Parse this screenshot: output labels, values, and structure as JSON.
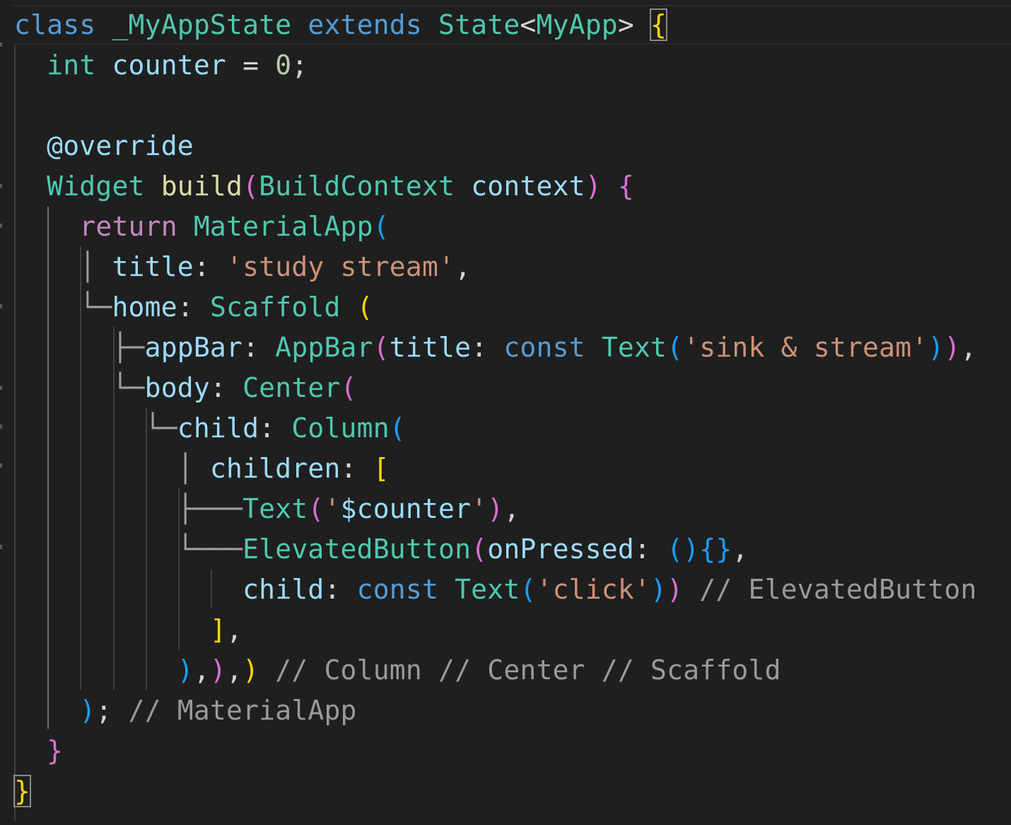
{
  "editor": {
    "language": "dart",
    "theme": "dark",
    "colors": {
      "background": "#1f1f1f",
      "keyword": "#569cd6",
      "control": "#c586c0",
      "type": "#4ec9b0",
      "variable": "#9cdcfe",
      "function": "#dcdcaa",
      "number": "#b5cea8",
      "string": "#ce9178",
      "comment": "#9a9a9a",
      "bracket_level_1": "#ffd700",
      "bracket_level_2": "#da70d6",
      "bracket_level_3": "#179fff"
    },
    "lines": [
      {
        "tokens": [
          {
            "t": "class",
            "c": "kw"
          },
          {
            "t": " "
          },
          {
            "t": "_MyAppState",
            "c": "type"
          },
          {
            "t": " "
          },
          {
            "t": "extends",
            "c": "kw"
          },
          {
            "t": " "
          },
          {
            "t": "State",
            "c": "type"
          },
          {
            "t": "<",
            "c": "punc"
          },
          {
            "t": "MyApp",
            "c": "type"
          },
          {
            "t": ">",
            "c": "punc"
          },
          {
            "t": " "
          },
          {
            "t": "{",
            "c": "br1",
            "box": true
          }
        ]
      },
      {
        "tokens": [
          {
            "t": "  "
          },
          {
            "t": "int",
            "c": "type"
          },
          {
            "t": " "
          },
          {
            "t": "counter",
            "c": "var"
          },
          {
            "t": " = ",
            "c": "punc"
          },
          {
            "t": "0",
            "c": "num"
          },
          {
            "t": ";",
            "c": "punc"
          }
        ]
      },
      {
        "tokens": []
      },
      {
        "tokens": [
          {
            "t": "  "
          },
          {
            "t": "@override",
            "c": "var"
          }
        ]
      },
      {
        "tokens": [
          {
            "t": "  "
          },
          {
            "t": "Widget",
            "c": "type"
          },
          {
            "t": " "
          },
          {
            "t": "build",
            "c": "fn"
          },
          {
            "t": "(",
            "c": "br2"
          },
          {
            "t": "BuildContext",
            "c": "type"
          },
          {
            "t": " "
          },
          {
            "t": "context",
            "c": "var"
          },
          {
            "t": ")",
            "c": "br2"
          },
          {
            "t": " "
          },
          {
            "t": "{",
            "c": "br2"
          }
        ]
      },
      {
        "tokens": [
          {
            "t": "    "
          },
          {
            "t": "return",
            "c": "ctrl"
          },
          {
            "t": " "
          },
          {
            "t": "MaterialApp",
            "c": "type"
          },
          {
            "t": "(",
            "c": "br3"
          }
        ]
      },
      {
        "tokens": [
          {
            "t": "    "
          },
          {
            "t": "│ ",
            "c": "tree"
          },
          {
            "t": "title",
            "c": "var"
          },
          {
            "t": ": ",
            "c": "punc"
          },
          {
            "t": "'study stream'",
            "c": "str"
          },
          {
            "t": ",",
            "c": "punc"
          }
        ]
      },
      {
        "tokens": [
          {
            "t": "    "
          },
          {
            "t": "└─",
            "c": "tree"
          },
          {
            "t": "home",
            "c": "var"
          },
          {
            "t": ": ",
            "c": "punc"
          },
          {
            "t": "Scaffold",
            "c": "type"
          },
          {
            "t": " "
          },
          {
            "t": "(",
            "c": "br1"
          }
        ]
      },
      {
        "tokens": [
          {
            "t": "      "
          },
          {
            "t": "├─",
            "c": "tree"
          },
          {
            "t": "appBar",
            "c": "var"
          },
          {
            "t": ": ",
            "c": "punc"
          },
          {
            "t": "AppBar",
            "c": "type"
          },
          {
            "t": "(",
            "c": "br2"
          },
          {
            "t": "title",
            "c": "var"
          },
          {
            "t": ": ",
            "c": "punc"
          },
          {
            "t": "const",
            "c": "kw"
          },
          {
            "t": " "
          },
          {
            "t": "Text",
            "c": "type"
          },
          {
            "t": "(",
            "c": "br3"
          },
          {
            "t": "'sink & stream'",
            "c": "str"
          },
          {
            "t": ")",
            "c": "br3"
          },
          {
            "t": ")",
            "c": "br2"
          },
          {
            "t": ",",
            "c": "punc"
          }
        ]
      },
      {
        "tokens": [
          {
            "t": "      "
          },
          {
            "t": "└─",
            "c": "tree"
          },
          {
            "t": "body",
            "c": "var"
          },
          {
            "t": ": ",
            "c": "punc"
          },
          {
            "t": "Center",
            "c": "type"
          },
          {
            "t": "(",
            "c": "br2"
          }
        ]
      },
      {
        "tokens": [
          {
            "t": "        "
          },
          {
            "t": "└─",
            "c": "tree"
          },
          {
            "t": "child",
            "c": "var"
          },
          {
            "t": ": ",
            "c": "punc"
          },
          {
            "t": "Column",
            "c": "type"
          },
          {
            "t": "(",
            "c": "br3"
          }
        ]
      },
      {
        "tokens": [
          {
            "t": "          "
          },
          {
            "t": "│ ",
            "c": "tree"
          },
          {
            "t": "children",
            "c": "var"
          },
          {
            "t": ": ",
            "c": "punc"
          },
          {
            "t": "[",
            "c": "br1"
          }
        ]
      },
      {
        "tokens": [
          {
            "t": "          "
          },
          {
            "t": "├───",
            "c": "tree"
          },
          {
            "t": "Text",
            "c": "type"
          },
          {
            "t": "(",
            "c": "br2"
          },
          {
            "t": "'",
            "c": "str"
          },
          {
            "t": "$counter",
            "c": "var"
          },
          {
            "t": "'",
            "c": "str"
          },
          {
            "t": ")",
            "c": "br2"
          },
          {
            "t": ",",
            "c": "punc"
          }
        ]
      },
      {
        "tokens": [
          {
            "t": "          "
          },
          {
            "t": "└───",
            "c": "tree"
          },
          {
            "t": "ElevatedButton",
            "c": "type"
          },
          {
            "t": "(",
            "c": "br2"
          },
          {
            "t": "onPressed",
            "c": "var"
          },
          {
            "t": ": ",
            "c": "punc"
          },
          {
            "t": "()",
            "c": "br3"
          },
          {
            "t": "{}",
            "c": "br3"
          },
          {
            "t": ",",
            "c": "punc"
          }
        ]
      },
      {
        "tokens": [
          {
            "t": "              "
          },
          {
            "t": "child",
            "c": "var"
          },
          {
            "t": ": ",
            "c": "punc"
          },
          {
            "t": "const",
            "c": "kw"
          },
          {
            "t": " "
          },
          {
            "t": "Text",
            "c": "type"
          },
          {
            "t": "(",
            "c": "br3"
          },
          {
            "t": "'click'",
            "c": "str"
          },
          {
            "t": ")",
            "c": "br3"
          },
          {
            "t": ")",
            "c": "br2"
          },
          {
            "t": " "
          },
          {
            "t": "// ElevatedButton",
            "c": "cmt"
          }
        ]
      },
      {
        "tokens": [
          {
            "t": "            "
          },
          {
            "t": "]",
            "c": "br1"
          },
          {
            "t": ",",
            "c": "punc"
          }
        ]
      },
      {
        "tokens": [
          {
            "t": "          "
          },
          {
            "t": ")",
            "c": "br3"
          },
          {
            "t": ",",
            "c": "punc"
          },
          {
            "t": ")",
            "c": "br2"
          },
          {
            "t": ",",
            "c": "punc"
          },
          {
            "t": ")",
            "c": "br1"
          },
          {
            "t": " "
          },
          {
            "t": "// Column // Center // Scaffold",
            "c": "cmt"
          }
        ]
      },
      {
        "tokens": [
          {
            "t": "    "
          },
          {
            "t": ")",
            "c": "br3"
          },
          {
            "t": ";",
            "c": "punc"
          },
          {
            "t": " "
          },
          {
            "t": "// MaterialApp",
            "c": "cmt"
          }
        ]
      },
      {
        "tokens": [
          {
            "t": "  "
          },
          {
            "t": "}",
            "c": "br2"
          }
        ]
      },
      {
        "tokens": [
          {
            "t": "}",
            "c": "br1",
            "box": true
          }
        ]
      }
    ]
  }
}
